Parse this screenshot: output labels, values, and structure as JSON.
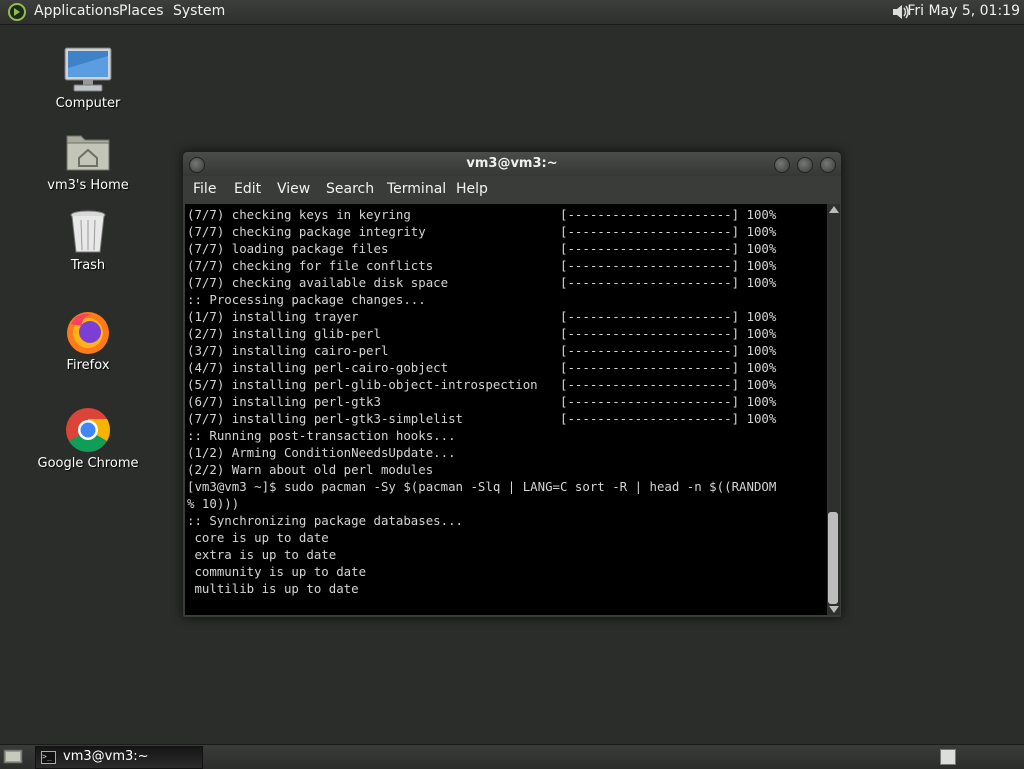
{
  "top_panel": {
    "menus": [
      "Applications",
      "Places",
      "System"
    ],
    "clock": "Fri May  5, 01:19"
  },
  "desktop_icons": [
    {
      "label": "Computer",
      "icon": "computer-icon"
    },
    {
      "label": "vm3's Home",
      "icon": "home-folder-icon"
    },
    {
      "label": "Trash",
      "icon": "trash-icon"
    },
    {
      "label": "Firefox",
      "icon": "firefox-icon"
    },
    {
      "label": "Google Chrome",
      "icon": "chrome-icon"
    }
  ],
  "window": {
    "title": "vm3@vm3:~",
    "menu": [
      "File",
      "Edit",
      "View",
      "Search",
      "Terminal",
      "Help"
    ]
  },
  "terminal": {
    "lines": [
      "(7/7) checking keys in keyring                    [----------------------] 100%",
      "(7/7) checking package integrity                  [----------------------] 100%",
      "(7/7) loading package files                       [----------------------] 100%",
      "(7/7) checking for file conflicts                 [----------------------] 100%",
      "(7/7) checking available disk space               [----------------------] 100%",
      ":: Processing package changes...",
      "(1/7) installing trayer                           [----------------------] 100%",
      "(2/7) installing glib-perl                        [----------------------] 100%",
      "(3/7) installing cairo-perl                       [----------------------] 100%",
      "(4/7) installing perl-cairo-gobject               [----------------------] 100%",
      "(5/7) installing perl-glib-object-introspection   [----------------------] 100%",
      "(6/7) installing perl-gtk3                        [----------------------] 100%",
      "(7/7) installing perl-gtk3-simplelist             [----------------------] 100%",
      ":: Running post-transaction hooks...",
      "(1/2) Arming ConditionNeedsUpdate...",
      "(2/2) Warn about old perl modules",
      "[vm3@vm3 ~]$ sudo pacman -Sy $(pacman -Slq | LANG=C sort -R | head -n $((RANDOM",
      "% 10)))",
      ":: Synchronizing package databases...",
      " core is up to date",
      " extra is up to date",
      " community is up to date",
      " multilib is up to date"
    ]
  },
  "taskbar": {
    "task_label": "vm3@vm3:~"
  }
}
